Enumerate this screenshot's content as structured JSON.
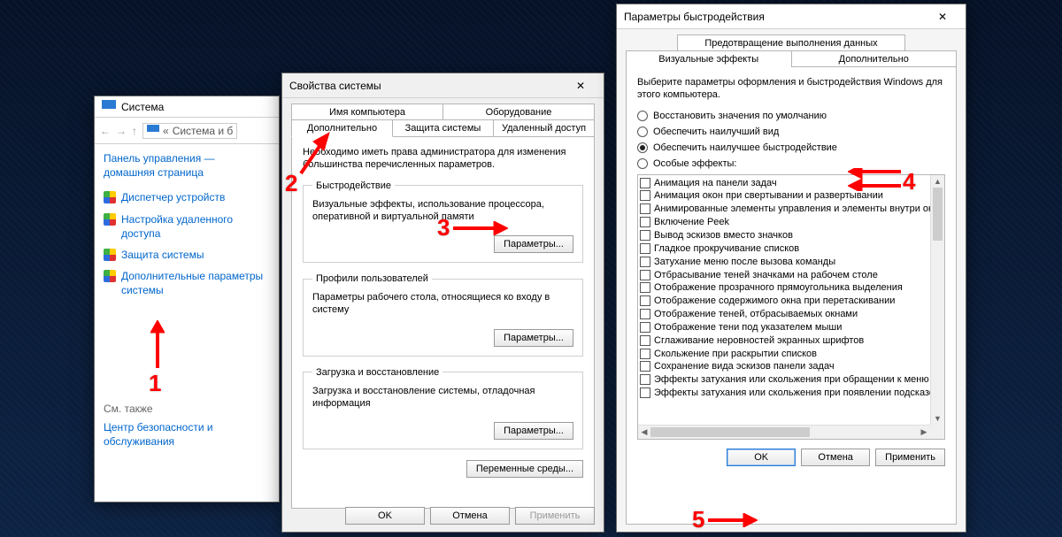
{
  "win1": {
    "title": "Система",
    "breadcrumb_prefix": "«",
    "breadcrumb": "Система и б",
    "homepage_line1": "Панель управления —",
    "homepage_line2": "домашняя страница",
    "links": [
      "Диспетчер устройств",
      "Настройка удаленного доступа",
      "Защита системы",
      "Дополнительные параметры системы"
    ],
    "see_also": "См. также",
    "sec_center_line1": "Центр безопасности и",
    "sec_center_line2": "обслуживания"
  },
  "win2": {
    "title": "Свойства системы",
    "tabs_top": [
      "Имя компьютера",
      "Оборудование"
    ],
    "tabs_bottom": [
      "Дополнительно",
      "Защита системы",
      "Удаленный доступ"
    ],
    "active_tab": "Дополнительно",
    "admin_text": "Необходимо иметь права администратора для изменения большинства перечисленных параметров.",
    "groups": [
      {
        "legend": "Быстродействие",
        "desc": "Визуальные эффекты, использование процессора, оперативной и виртуальной памяти",
        "btn": "Параметры..."
      },
      {
        "legend": "Профили пользователей",
        "desc": "Параметры рабочего стола, относящиеся ко входу в систему",
        "btn": "Параметры..."
      },
      {
        "legend": "Загрузка и восстановление",
        "desc": "Загрузка и восстановление системы, отладочная информация",
        "btn": "Параметры..."
      }
    ],
    "env_btn": "Переменные среды...",
    "ok": "OK",
    "cancel": "Отмена",
    "apply": "Применить"
  },
  "win3": {
    "title": "Параметры быстродействия",
    "tab_dep": "Предотвращение выполнения данных",
    "tabs": [
      "Визуальные эффекты",
      "Дополнительно"
    ],
    "active_tab": "Визуальные эффекты",
    "intro": "Выберите параметры оформления и быстродействия Windows для этого компьютера.",
    "radios": [
      "Восстановить значения по умолчанию",
      "Обеспечить наилучший вид",
      "Обеспечить наилучшее быстродействие",
      "Особые эффекты:"
    ],
    "radio_selected_index": 2,
    "checks": [
      "Анимация на панели задач",
      "Анимация окон при свертывании и развертывании",
      "Анимированные элементы управления и элементы внутри окна",
      "Включение Peek",
      "Вывод эскизов вместо значков",
      "Гладкое прокручивание списков",
      "Затухание меню после вызова команды",
      "Отбрасывание теней значками на рабочем столе",
      "Отображение прозрачного прямоугольника выделения",
      "Отображение содержимого окна при перетаскивании",
      "Отображение теней, отбрасываемых окнами",
      "Отображение тени под указателем мыши",
      "Сглаживание неровностей экранных шрифтов",
      "Скольжение при раскрытии списков",
      "Сохранение вида эскизов панели задач",
      "Эффекты затухания или скольжения при обращении к меню",
      "Эффекты затухания или скольжения при появлении подсказок"
    ],
    "ok": "OK",
    "cancel": "Отмена",
    "apply": "Применить"
  },
  "annotations": {
    "n1": "1",
    "n2": "2",
    "n3": "3",
    "n4": "4",
    "n5": "5"
  }
}
